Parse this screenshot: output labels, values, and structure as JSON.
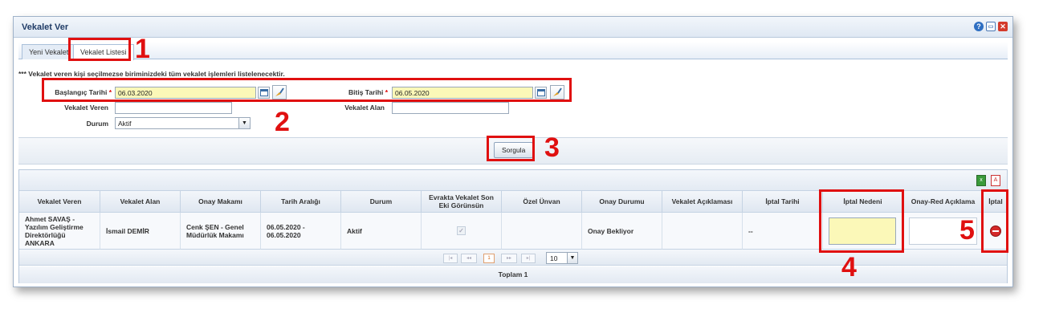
{
  "window": {
    "title": "Vekalet Ver",
    "icons": [
      "help-icon",
      "minimize-icon",
      "close-icon"
    ]
  },
  "tabs": [
    {
      "label": "Yeni Vekalet"
    },
    {
      "label": "Vekalet Listesi"
    }
  ],
  "info_text": "*** Vekalet veren kişi seçilmezse biriminizdeki tüm vekalet işlemleri listelenecektir.",
  "form": {
    "start_label": "Başlangıç Tarihi",
    "start_value": "06.03.2020",
    "end_label": "Bitiş Tarihi",
    "end_value": "06.05.2020",
    "giver_label": "Vekalet Veren",
    "giver_value": "",
    "receiver_label": "Vekalet Alan",
    "receiver_value": "",
    "status_label": "Durum",
    "status_value": "Aktif",
    "required_mark": "*"
  },
  "query_button": "Sorgula",
  "grid": {
    "columns": [
      "Vekalet Veren",
      "Vekalet Alan",
      "Onay Makamı",
      "Tarih Aralığı",
      "Durum",
      "Evrakta Vekalet Son Eki Görünsün",
      "Özel Ünvan",
      "Onay Durumu",
      "Vekalet Açıklaması",
      "İptal Tarihi",
      "İptal Nedeni",
      "Onay-Red Açıklama",
      "İptal"
    ],
    "rows": [
      {
        "veren": "Ahmet SAVAŞ - Yazılım Geliştirme Direktörlüğü ANKARA",
        "alan": "İsmail DEMİR",
        "makam": "Cenk ŞEN - Genel Müdürlük Makamı",
        "tarih": "06.05.2020 - 06.05.2020",
        "durum": "Aktif",
        "son_eki": "✓",
        "unvan": "",
        "onay": "Onay Bekliyor",
        "aciklama": "",
        "iptal_tarihi": "--",
        "iptal_nedeni": "",
        "onay_red": ""
      }
    ],
    "pager": {
      "first": "|◂",
      "prev": "◂◂",
      "page": "1",
      "next": "▸▸",
      "last": "▸|",
      "page_size": "10"
    },
    "total": "Toplam 1"
  },
  "annotations": [
    "1",
    "2",
    "3",
    "4",
    "5"
  ],
  "colors": {
    "annotation": "#e01010",
    "highlight_input": "#fbf8b8",
    "title": "#1f3b66"
  }
}
